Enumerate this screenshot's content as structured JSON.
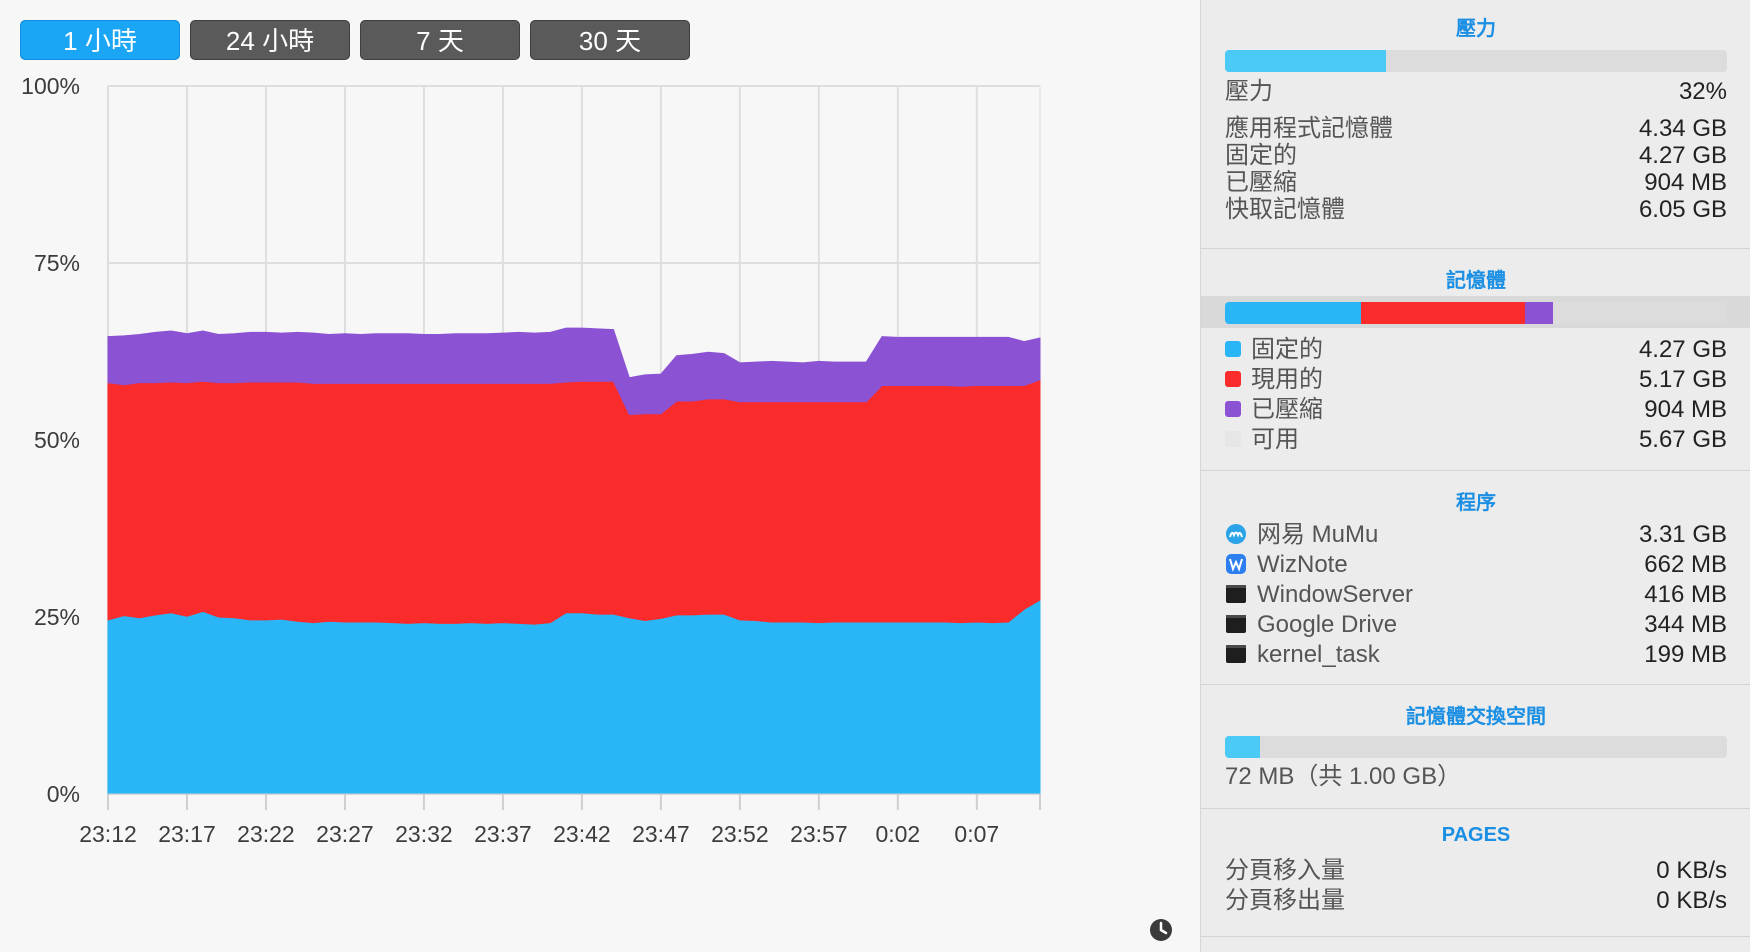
{
  "tabs": [
    {
      "label": "1 小時",
      "active": true
    },
    {
      "label": "24 小時",
      "active": false
    },
    {
      "label": "7 天",
      "active": false
    },
    {
      "label": "30 天",
      "active": false
    }
  ],
  "chart_data": {
    "type": "area",
    "stacked": true,
    "ylim": [
      0,
      100
    ],
    "yticks": [
      "100%",
      "75%",
      "50%",
      "25%",
      "0%"
    ],
    "xticks": [
      "23:12",
      "23:17",
      "23:22",
      "23:27",
      "23:32",
      "23:37",
      "23:42",
      "23:47",
      "23:52",
      "23:57",
      "0:02",
      "0:07"
    ],
    "grid": true,
    "colors": [
      "#2ab5f6",
      "#fa2b2b",
      "#8b52d4"
    ],
    "x": [
      "23:12",
      "23:13",
      "23:14",
      "23:15",
      "23:16",
      "23:17",
      "23:18",
      "23:19",
      "23:20",
      "23:21",
      "23:22",
      "23:23",
      "23:24",
      "23:25",
      "23:26",
      "23:27",
      "23:28",
      "23:29",
      "23:30",
      "23:31",
      "23:32",
      "23:33",
      "23:34",
      "23:35",
      "23:36",
      "23:37",
      "23:38",
      "23:39",
      "23:40",
      "23:41",
      "23:42",
      "23:43",
      "23:44",
      "23:45",
      "23:46",
      "23:47",
      "23:48",
      "23:49",
      "23:50",
      "23:51",
      "23:52",
      "23:53",
      "23:54",
      "23:55",
      "23:56",
      "23:57",
      "23:58",
      "23:59",
      "0:00",
      "0:01",
      "0:02",
      "0:03",
      "0:04",
      "0:05",
      "0:06",
      "0:07",
      "0:08",
      "0:09",
      "0:10",
      "0:11"
    ],
    "series": [
      {
        "values": [
          24.6,
          25.2,
          24.9,
          25.3,
          25.6,
          25.1,
          25.8,
          25.0,
          24.9,
          24.6,
          24.6,
          24.7,
          24.4,
          24.2,
          24.4,
          24.3,
          24.3,
          24.3,
          24.2,
          24.1,
          24.2,
          24.1,
          24.1,
          24.2,
          24.1,
          24.2,
          24.1,
          24.0,
          24.2,
          25.6,
          25.6,
          25.4,
          25.4,
          24.9,
          24.5,
          24.8,
          25.3,
          25.3,
          25.4,
          25.4,
          24.6,
          24.5,
          24.3,
          24.3,
          24.3,
          24.2,
          24.3,
          24.3,
          24.3,
          24.3,
          24.3,
          24.3,
          24.3,
          24.3,
          24.2,
          24.3,
          24.2,
          24.3,
          26.1,
          27.4
        ]
      },
      {
        "values": [
          33.5,
          32.6,
          33.2,
          32.8,
          32.6,
          33.0,
          32.5,
          33.1,
          33.2,
          33.6,
          33.6,
          33.5,
          33.8,
          33.8,
          33.6,
          33.7,
          33.7,
          33.7,
          33.8,
          33.9,
          33.8,
          33.9,
          33.9,
          33.8,
          33.9,
          33.8,
          33.9,
          34.0,
          33.8,
          32.6,
          32.7,
          32.9,
          32.9,
          28.7,
          29.2,
          28.9,
          30.2,
          30.2,
          30.4,
          30.4,
          30.8,
          30.9,
          31.1,
          31.1,
          31.1,
          31.2,
          31.1,
          31.1,
          31.1,
          33.4,
          33.4,
          33.4,
          33.4,
          33.4,
          33.4,
          33.4,
          33.5,
          33.4,
          31.6,
          31.1
        ]
      },
      {
        "values": [
          6.5,
          6.9,
          6.8,
          7.1,
          7.2,
          6.9,
          7.1,
          6.8,
          6.9,
          7.0,
          7.0,
          6.9,
          7.0,
          7.1,
          6.9,
          7.0,
          6.9,
          7.0,
          7.0,
          7.0,
          6.9,
          6.9,
          7.0,
          7.0,
          7.0,
          7.1,
          7.2,
          7.1,
          7.2,
          7.6,
          7.5,
          7.4,
          7.3,
          5.2,
          5.5,
          5.6,
          6.4,
          6.6,
          6.6,
          6.4,
          5.5,
          5.6,
          5.7,
          5.6,
          5.5,
          5.7,
          5.6,
          5.6,
          5.6,
          6.9,
          6.8,
          6.8,
          6.8,
          6.8,
          6.9,
          6.8,
          6.8,
          6.8,
          6.2,
          5.9
        ]
      }
    ]
  },
  "panel": {
    "pressure": {
      "title": "壓力",
      "bar": {
        "fraction": 0.32,
        "color": "#4ccaf7"
      },
      "rows": [
        {
          "label": "壓力",
          "value": "32%"
        },
        {
          "label": "應用程式記憶體",
          "value": "4.34 GB"
        },
        {
          "label": "固定的",
          "value": "4.27 GB"
        },
        {
          "label": "已壓縮",
          "value": "904 MB"
        },
        {
          "label": "快取記憶體",
          "value": "6.05 GB"
        }
      ]
    },
    "memory": {
      "title": "記憶體",
      "bar_segments": [
        {
          "fraction": 0.27,
          "color": "#2ab5f6"
        },
        {
          "fraction": 0.327,
          "color": "#fa2b2b"
        },
        {
          "fraction": 0.057,
          "color": "#8b52d4"
        }
      ],
      "legend": [
        {
          "label": "固定的",
          "value": "4.27 GB",
          "color": "#2ab5f6"
        },
        {
          "label": "現用的",
          "value": "5.17 GB",
          "color": "#fa2b2b"
        },
        {
          "label": "已壓縮",
          "value": "904 MB",
          "color": "#8b52d4"
        },
        {
          "label": "可用",
          "value": "5.67 GB",
          "color": "#e6e6e6"
        }
      ]
    },
    "processes": {
      "title": "程序",
      "items": [
        {
          "name": "网易 MuMu",
          "value": "3.31 GB",
          "icon": "mumu-icon"
        },
        {
          "name": "WizNote",
          "value": "662 MB",
          "icon": "wiznote-icon"
        },
        {
          "name": "WindowServer",
          "value": "416 MB",
          "icon": "terminal-icon"
        },
        {
          "name": "Google Drive",
          "value": "344 MB",
          "icon": "terminal-icon"
        },
        {
          "name": "kernel_task",
          "value": "199 MB",
          "icon": "terminal-icon"
        }
      ]
    },
    "swap": {
      "title": "記憶體交換空間",
      "bar": {
        "fraction": 0.07,
        "color": "#4ccaf7"
      },
      "text": "72 MB（共 1.00 GB）"
    },
    "pages": {
      "title": "PAGES",
      "rows": [
        {
          "label": "分頁移入量",
          "value": "0 KB/s"
        },
        {
          "label": "分頁移出量",
          "value": "0 KB/s"
        }
      ]
    }
  }
}
